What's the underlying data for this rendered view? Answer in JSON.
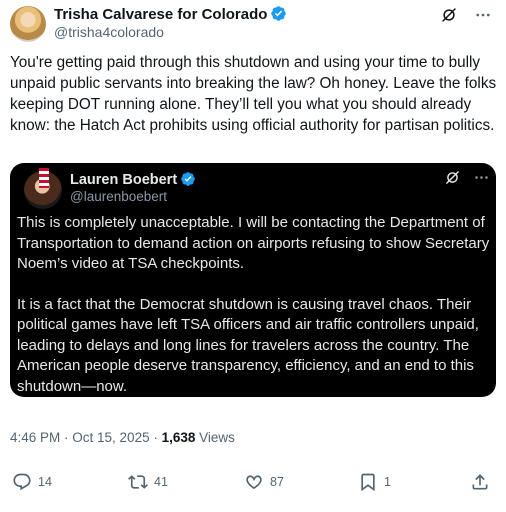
{
  "tweet": {
    "author": {
      "name": "Trisha Calvarese for Colorado",
      "handle": "@trisha4colorado",
      "verified": true
    },
    "text": "You're getting paid through this shutdown and using your time to bully unpaid public servants into breaking the law? Oh honey. Leave the folks keeping DOT running alone. They’ll tell you what you should already know: the Hatch Act prohibits using official authority for partisan politics.",
    "quoted": {
      "author": {
        "name": "Lauren Boebert",
        "handle": "@laurenboebert",
        "verified": true
      },
      "paragraphs": [
        "This is completely unacceptable. I will be contacting the Department of Transportation to demand action on airports refusing to show Secretary Noem’s video at TSA checkpoints.",
        "It is a fact that the Democrat shutdown is causing travel chaos. Their political games have left TSA officers and air traffic controllers unpaid, leading to delays and long lines for travelers across the country. The American people deserve transparency, efficiency, and an end to this shutdown—now."
      ]
    },
    "meta": {
      "time": "4:46 PM",
      "sep1": " · ",
      "date": "Oct 15, 2025",
      "sep2": " · ",
      "views_count": "1,638",
      "views_label": " Views"
    },
    "actions": {
      "replies": "14",
      "reposts": "41",
      "likes": "87",
      "bookmarks": "1"
    }
  },
  "colors": {
    "text": "#0f1419",
    "secondary": "#536471",
    "verified": "#1d9bf0",
    "quote_bg": "#000000"
  },
  "icons": [
    "verified-badge-icon",
    "grok-icon",
    "more-icon",
    "reply-icon",
    "repost-icon",
    "like-icon",
    "bookmark-icon",
    "share-icon"
  ]
}
